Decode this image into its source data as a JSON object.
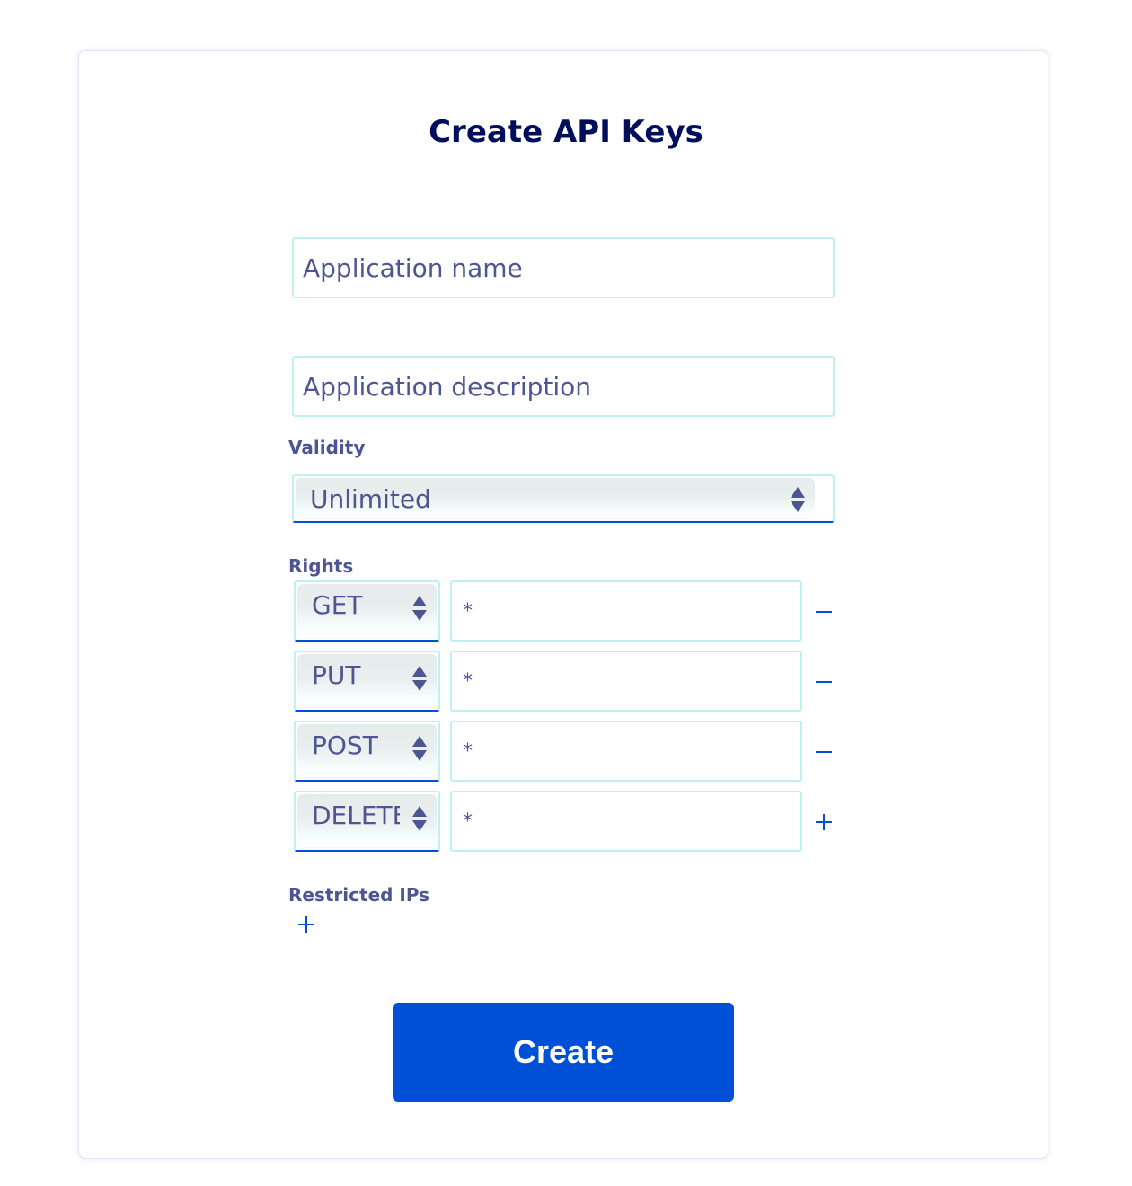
{
  "form": {
    "title": "Create API Keys",
    "app_name_placeholder": "Application name",
    "app_description_placeholder": "Application description",
    "validity_label": "Validity",
    "validity_value": "Unlimited",
    "rights_label": "Rights",
    "rights": [
      {
        "method": "GET",
        "path": "*",
        "action_icon": "minus-icon"
      },
      {
        "method": "PUT",
        "path": "*",
        "action_icon": "minus-icon"
      },
      {
        "method": "POST",
        "path": "*",
        "action_icon": "minus-icon"
      },
      {
        "method": "DELETE",
        "path": "*",
        "action_icon": "plus-icon"
      }
    ],
    "restricted_ips_label": "Restricted IPs",
    "restricted_ips_add_icon": "plus-icon",
    "create_label": "Create"
  },
  "colors": {
    "title": "#000e5c",
    "text": "#4d5693",
    "input_border": "#bff1f4",
    "accent": "#0050d7",
    "button_text": "#ffffff"
  }
}
